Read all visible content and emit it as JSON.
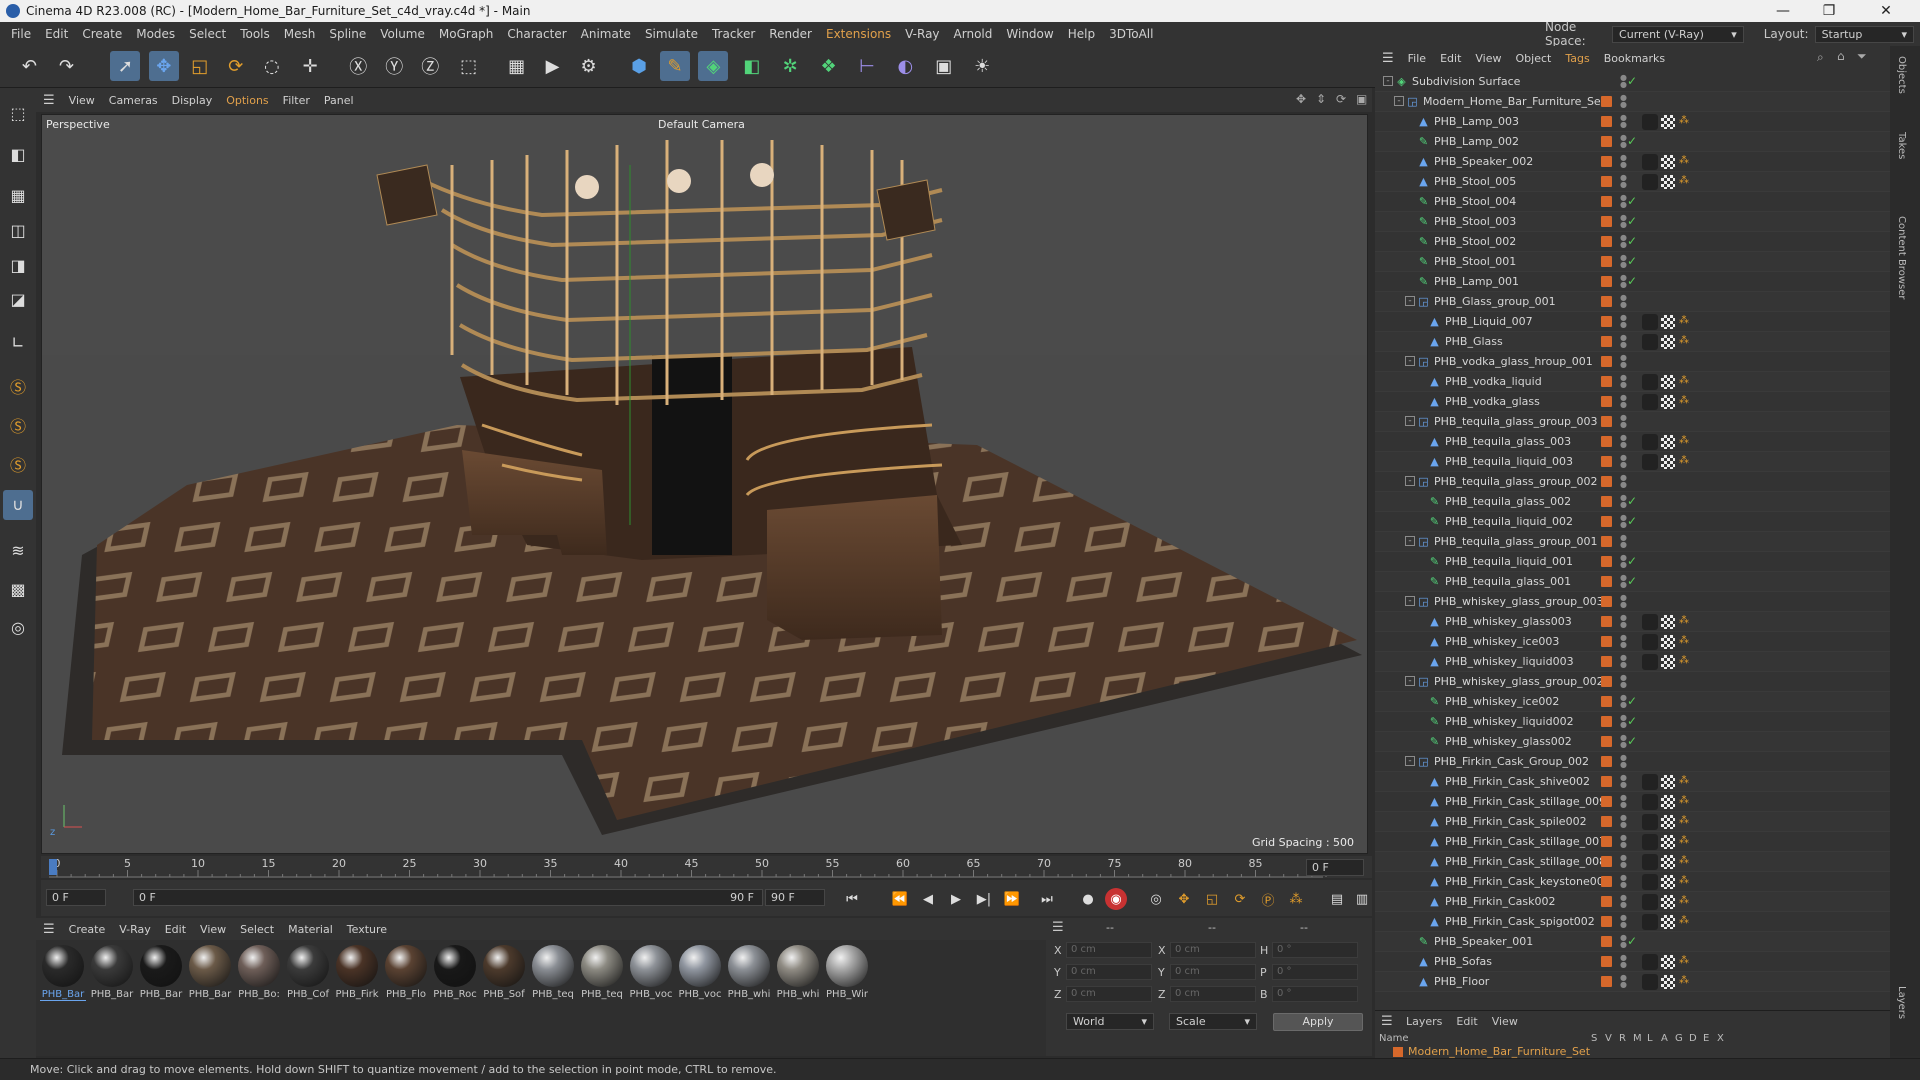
{
  "window": {
    "title": "Cinema 4D R23.008 (RC) - [Modern_Home_Bar_Furniture_Set_c4d_vray.c4d *] - Main",
    "minimize": "—",
    "maximize": "❐",
    "close": "✕"
  },
  "menubar": [
    "File",
    "Edit",
    "Create",
    "Modes",
    "Select",
    "Tools",
    "Mesh",
    "Spline",
    "Volume",
    "MoGraph",
    "Character",
    "Animate",
    "Simulate",
    "Tracker",
    "Render",
    "Extensions",
    "V-Ray",
    "Arnold",
    "Window",
    "Help",
    "3DToAll"
  ],
  "node_space": {
    "label": "Node Space:",
    "value": "Current (V-Ray)"
  },
  "layout": {
    "label": "Layout:",
    "value": "Startup"
  },
  "toolbar_icons": [
    "undo-icon",
    "redo-icon",
    "select-icon",
    "move-icon",
    "scale-icon",
    "rotate-icon",
    "recent-tool-icon",
    "move-plus-icon",
    "x-axis-icon",
    "y-axis-icon",
    "z-axis-icon",
    "coordinate-system-icon",
    "render-region-icon",
    "render-view-icon",
    "render-settings-icon",
    "cube-icon",
    "pen-icon",
    "subdivision-icon",
    "extrude-icon",
    "mograph-cloner-icon",
    "deformer-icon",
    "field-icon",
    "scene-icon",
    "camera-icon",
    "light-icon"
  ],
  "viewport": {
    "menu": [
      "View",
      "Cameras",
      "Display",
      "Options",
      "Filter",
      "Panel"
    ],
    "name": "Perspective",
    "camera": "Default Camera",
    "grid_spacing": "Grid Spacing : 500 cm"
  },
  "timeline": {
    "ticks": [
      "0",
      "5",
      "10",
      "15",
      "20",
      "25",
      "30",
      "35",
      "40",
      "45",
      "50",
      "55",
      "60",
      "65",
      "70",
      "75",
      "80",
      "85",
      "90"
    ],
    "current_frame": "0 F"
  },
  "transport": {
    "start": "0 F",
    "current": "0 F",
    "end": "90 F",
    "end2": "90 F"
  },
  "material_menu": [
    "Create",
    "V-Ray",
    "Edit",
    "View",
    "Select",
    "Material",
    "Texture"
  ],
  "materials": [
    {
      "label": "PHB_Bar",
      "color": "#2a2a2a"
    },
    {
      "label": "PHB_Bar",
      "color": "#3a3a3a"
    },
    {
      "label": "PHB_Bar",
      "color": "#1a1a1a"
    },
    {
      "label": "PHB_Bar",
      "color": "#6b5a48"
    },
    {
      "label": "PHB_Bo:",
      "color": "#6e5e58"
    },
    {
      "label": "PHB_Cof",
      "color": "#3b3b3b"
    },
    {
      "label": "PHB_Firk",
      "color": "#4a3326"
    },
    {
      "label": "PHB_Flo",
      "color": "#5a4232"
    },
    {
      "label": "PHB_Roc",
      "color": "#181818"
    },
    {
      "label": "PHB_Sof",
      "color": "#4c3a2c"
    },
    {
      "label": "PHB_teq",
      "color": "#8a8e94"
    },
    {
      "label": "PHB_teq",
      "color": "#8c8a82"
    },
    {
      "label": "PHB_voc",
      "color": "#8e9298"
    },
    {
      "label": "PHB_voc",
      "color": "#9096a0"
    },
    {
      "label": "PHB_whi",
      "color": "#8c9096"
    },
    {
      "label": "PHB_whi",
      "color": "#908c84"
    },
    {
      "label": "PHB_Wir",
      "color": "#a8a8a8"
    }
  ],
  "coords": {
    "col_heads": [
      "--",
      "--",
      "--"
    ],
    "rows": [
      {
        "a": "X",
        "v1": "0 cm",
        "b": "X",
        "v2": "0 cm",
        "c": "H",
        "v3": "0 °"
      },
      {
        "a": "Y",
        "v1": "0 cm",
        "b": "Y",
        "v2": "0 cm",
        "c": "P",
        "v3": "0 °"
      },
      {
        "a": "Z",
        "v1": "0 cm",
        "b": "Z",
        "v2": "0 cm",
        "c": "B",
        "v3": "0 °"
      }
    ],
    "world": "World",
    "scale": "Scale",
    "apply": "Apply"
  },
  "status": "Move: Click and drag to move elements. Hold down SHIFT to quantize movement / add to the selection in point mode, CTRL to remove.",
  "object_manager": {
    "menu": [
      "File",
      "Edit",
      "View",
      "Object",
      "Tags",
      "Bookmarks"
    ],
    "objects": [
      {
        "name": "Subdivision Surface",
        "depth": 0,
        "icon": "subdivision",
        "expander": "-",
        "check": true,
        "tags": false
      },
      {
        "name": "Modern_Home_Bar_Furniture_Set",
        "depth": 1,
        "icon": "null",
        "expander": "-",
        "check": false,
        "tags": false
      },
      {
        "name": "PHB_Lamp_003",
        "depth": 2,
        "icon": "poly",
        "expander": "",
        "check": false,
        "tags": true
      },
      {
        "name": "PHB_Lamp_002",
        "depth": 2,
        "icon": "green",
        "expander": "",
        "check": true,
        "tags": false
      },
      {
        "name": "PHB_Speaker_002",
        "depth": 2,
        "icon": "poly",
        "expander": "",
        "check": false,
        "tags": true
      },
      {
        "name": "PHB_Stool_005",
        "depth": 2,
        "icon": "poly",
        "expander": "",
        "check": false,
        "tags": true
      },
      {
        "name": "PHB_Stool_004",
        "depth": 2,
        "icon": "green",
        "expander": "",
        "check": true,
        "tags": false
      },
      {
        "name": "PHB_Stool_003",
        "depth": 2,
        "icon": "green",
        "expander": "",
        "check": true,
        "tags": false
      },
      {
        "name": "PHB_Stool_002",
        "depth": 2,
        "icon": "green",
        "expander": "",
        "check": true,
        "tags": false
      },
      {
        "name": "PHB_Stool_001",
        "depth": 2,
        "icon": "green",
        "expander": "",
        "check": true,
        "tags": false
      },
      {
        "name": "PHB_Lamp_001",
        "depth": 2,
        "icon": "green",
        "expander": "",
        "check": true,
        "tags": false
      },
      {
        "name": "PHB_Glass_group_001",
        "depth": 2,
        "icon": "null",
        "expander": "-",
        "check": false,
        "tags": false
      },
      {
        "name": "PHB_Liquid_007",
        "depth": 3,
        "icon": "poly",
        "expander": "",
        "check": false,
        "tags": true
      },
      {
        "name": "PHB_Glass",
        "depth": 3,
        "icon": "poly",
        "expander": "",
        "check": false,
        "tags": true
      },
      {
        "name": "PHB_vodka_glass_hroup_001",
        "depth": 2,
        "icon": "null",
        "expander": "-",
        "check": false,
        "tags": false
      },
      {
        "name": "PHB_vodka_liquid",
        "depth": 3,
        "icon": "poly",
        "expander": "",
        "check": false,
        "tags": true
      },
      {
        "name": "PHB_vodka_glass",
        "depth": 3,
        "icon": "poly",
        "expander": "",
        "check": false,
        "tags": true
      },
      {
        "name": "PHB_tequila_glass_group_003",
        "depth": 2,
        "icon": "null",
        "expander": "-",
        "check": false,
        "tags": false
      },
      {
        "name": "PHB_tequila_glass_003",
        "depth": 3,
        "icon": "poly",
        "expander": "",
        "check": false,
        "tags": true
      },
      {
        "name": "PHB_tequila_liquid_003",
        "depth": 3,
        "icon": "poly",
        "expander": "",
        "check": false,
        "tags": true
      },
      {
        "name": "PHB_tequila_glass_group_002",
        "depth": 2,
        "icon": "null",
        "expander": "-",
        "check": false,
        "tags": false
      },
      {
        "name": "PHB_tequila_glass_002",
        "depth": 3,
        "icon": "green",
        "expander": "",
        "check": true,
        "tags": false
      },
      {
        "name": "PHB_tequila_liquid_002",
        "depth": 3,
        "icon": "green",
        "expander": "",
        "check": true,
        "tags": false
      },
      {
        "name": "PHB_tequila_glass_group_001",
        "depth": 2,
        "icon": "null",
        "expander": "-",
        "check": false,
        "tags": false
      },
      {
        "name": "PHB_tequila_liquid_001",
        "depth": 3,
        "icon": "green",
        "expander": "",
        "check": true,
        "tags": false
      },
      {
        "name": "PHB_tequila_glass_001",
        "depth": 3,
        "icon": "green",
        "expander": "",
        "check": true,
        "tags": false
      },
      {
        "name": "PHB_whiskey_glass_group_003",
        "depth": 2,
        "icon": "null",
        "expander": "-",
        "check": false,
        "tags": false
      },
      {
        "name": "PHB_whiskey_glass003",
        "depth": 3,
        "icon": "poly",
        "expander": "",
        "check": false,
        "tags": true
      },
      {
        "name": "PHB_whiskey_ice003",
        "depth": 3,
        "icon": "poly",
        "expander": "",
        "check": false,
        "tags": true
      },
      {
        "name": "PHB_whiskey_liquid003",
        "depth": 3,
        "icon": "poly",
        "expander": "",
        "check": false,
        "tags": true
      },
      {
        "name": "PHB_whiskey_glass_group_002",
        "depth": 2,
        "icon": "null",
        "expander": "-",
        "check": false,
        "tags": false
      },
      {
        "name": "PHB_whiskey_ice002",
        "depth": 3,
        "icon": "green",
        "expander": "",
        "check": true,
        "tags": false
      },
      {
        "name": "PHB_whiskey_liquid002",
        "depth": 3,
        "icon": "green",
        "expander": "",
        "check": true,
        "tags": false
      },
      {
        "name": "PHB_whiskey_glass002",
        "depth": 3,
        "icon": "green",
        "expander": "",
        "check": true,
        "tags": false
      },
      {
        "name": "PHB_Firkin_Cask_Group_002",
        "depth": 2,
        "icon": "null",
        "expander": "-",
        "check": false,
        "tags": false
      },
      {
        "name": "PHB_Firkin_Cask_shive002",
        "depth": 3,
        "icon": "poly",
        "expander": "",
        "check": false,
        "tags": true
      },
      {
        "name": "PHB_Firkin_Cask_stillage_009",
        "depth": 3,
        "icon": "poly",
        "expander": "",
        "check": false,
        "tags": true
      },
      {
        "name": "PHB_Firkin_Cask_spile002",
        "depth": 3,
        "icon": "poly",
        "expander": "",
        "check": false,
        "tags": true
      },
      {
        "name": "PHB_Firkin_Cask_stillage_007",
        "depth": 3,
        "icon": "poly",
        "expander": "",
        "check": false,
        "tags": true
      },
      {
        "name": "PHB_Firkin_Cask_stillage_008",
        "depth": 3,
        "icon": "poly",
        "expander": "",
        "check": false,
        "tags": true
      },
      {
        "name": "PHB_Firkin_Cask_keystone002",
        "depth": 3,
        "icon": "poly",
        "expander": "",
        "check": false,
        "tags": true
      },
      {
        "name": "PHB_Firkin_Cask002",
        "depth": 3,
        "icon": "poly",
        "expander": "",
        "check": false,
        "tags": true
      },
      {
        "name": "PHB_Firkin_Cask_spigot002",
        "depth": 3,
        "icon": "poly",
        "expander": "",
        "check": false,
        "tags": true
      },
      {
        "name": "PHB_Speaker_001",
        "depth": 2,
        "icon": "green",
        "expander": "",
        "check": true,
        "tags": false
      },
      {
        "name": "PHB_Sofas",
        "depth": 2,
        "icon": "poly",
        "expander": "",
        "check": false,
        "tags": true
      },
      {
        "name": "PHB_Floor",
        "depth": 2,
        "icon": "poly",
        "expander": "",
        "check": false,
        "tags": true
      }
    ]
  },
  "layers": {
    "menu": [
      "Layers",
      "Edit",
      "View"
    ],
    "cols_label": "Name",
    "cols": [
      "S",
      "V",
      "R",
      "M",
      "L",
      "A",
      "G",
      "D",
      "E",
      "X"
    ],
    "item": "Modern_Home_Bar_Furniture_Set"
  },
  "right_tabs": [
    "Objects",
    "Takes",
    "Content Browser",
    "Layers"
  ],
  "colors": {
    "accent": "#e1a04b",
    "selected": "#4e6e90",
    "layer": "#d6682b"
  }
}
